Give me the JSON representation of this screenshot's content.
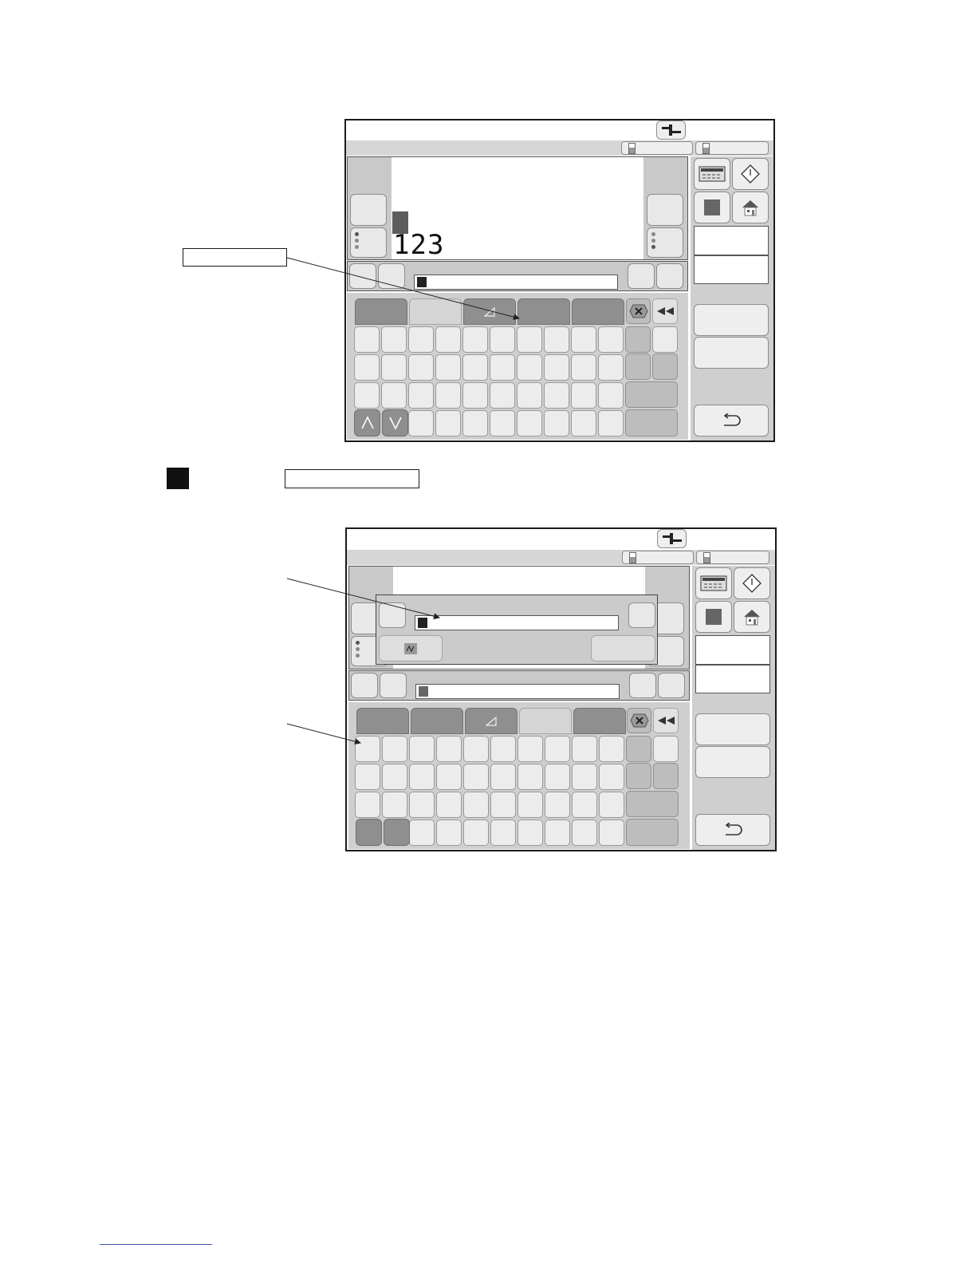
{
  "screen1": {
    "message_preview_text": "123"
  },
  "colors": {
    "frame": "#1a1a1a",
    "panel_gray": "#c9c9c9",
    "key_light": "#ececec",
    "key_dark": "#8f8f8f",
    "cursor": "#222222"
  },
  "icons": {
    "top_connector": "connector-icon",
    "printhead": "printhead-icon",
    "start": "start-diamond-icon",
    "stop": "stop-square-icon",
    "home": "home-icon",
    "back": "return-arrow-icon",
    "delete": "delete-x-icon",
    "rewind": "rewind-icon",
    "up": "chevron-up-icon",
    "down": "chevron-down-icon",
    "triangle": "triangle-icon",
    "function": "function-icon"
  }
}
